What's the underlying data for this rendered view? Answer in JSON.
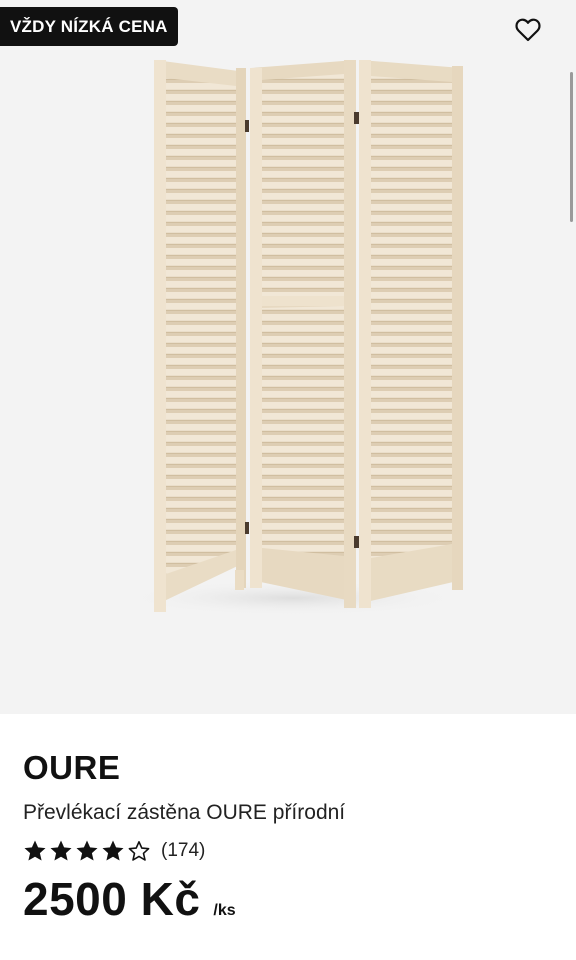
{
  "badge": {
    "label": "VŽDY NÍZKÁ CENA"
  },
  "favorite": {
    "icon": "heart-icon"
  },
  "product": {
    "brand": "OURE",
    "description": "Převlékací zástěna OURE přírodní",
    "rating": 4,
    "rating_max": 5,
    "review_count": "(174)",
    "price": "2500 Kč",
    "unit": "/ks"
  },
  "colors": {
    "image_background": "#f3f3f3",
    "badge_background": "#111111",
    "wood": "#efe4d2"
  }
}
